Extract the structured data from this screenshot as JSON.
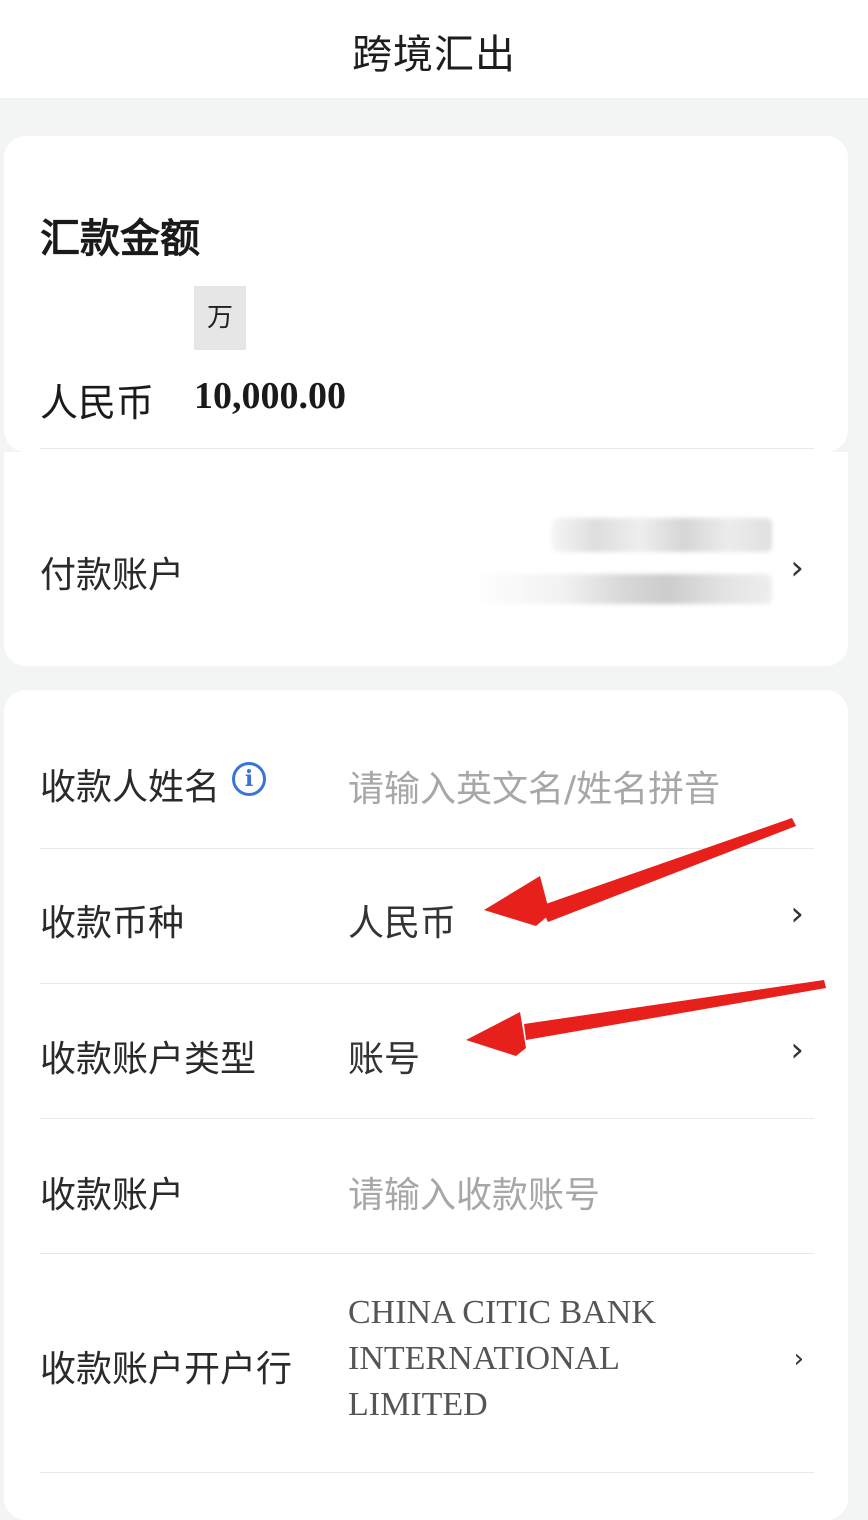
{
  "header": {
    "title": "跨境汇出"
  },
  "amount_card": {
    "title": "汇款金额",
    "unit_badge": "万",
    "currency": "人民币",
    "amount": "10,000.00"
  },
  "payer_account": {
    "label": "付款账户"
  },
  "payee": {
    "name": {
      "label": "收款人姓名",
      "placeholder": "请输入英文名/姓名拼音"
    },
    "currency": {
      "label": "收款币种",
      "value": "人民币"
    },
    "account_type": {
      "label": "收款账户类型",
      "value": "账号"
    },
    "account": {
      "label": "收款账户",
      "placeholder": "请输入收款账号"
    },
    "bank": {
      "label": "收款账户开户行",
      "value": "CHINA CITIC BANK INTERNATIONAL LIMITED"
    }
  },
  "icons": {
    "info": "info-icon",
    "chevron": "chevron-right-icon"
  },
  "colors": {
    "annotation_arrow": "#e8201c",
    "info_icon": "#3a74d6",
    "placeholder": "#a7a7a7"
  }
}
